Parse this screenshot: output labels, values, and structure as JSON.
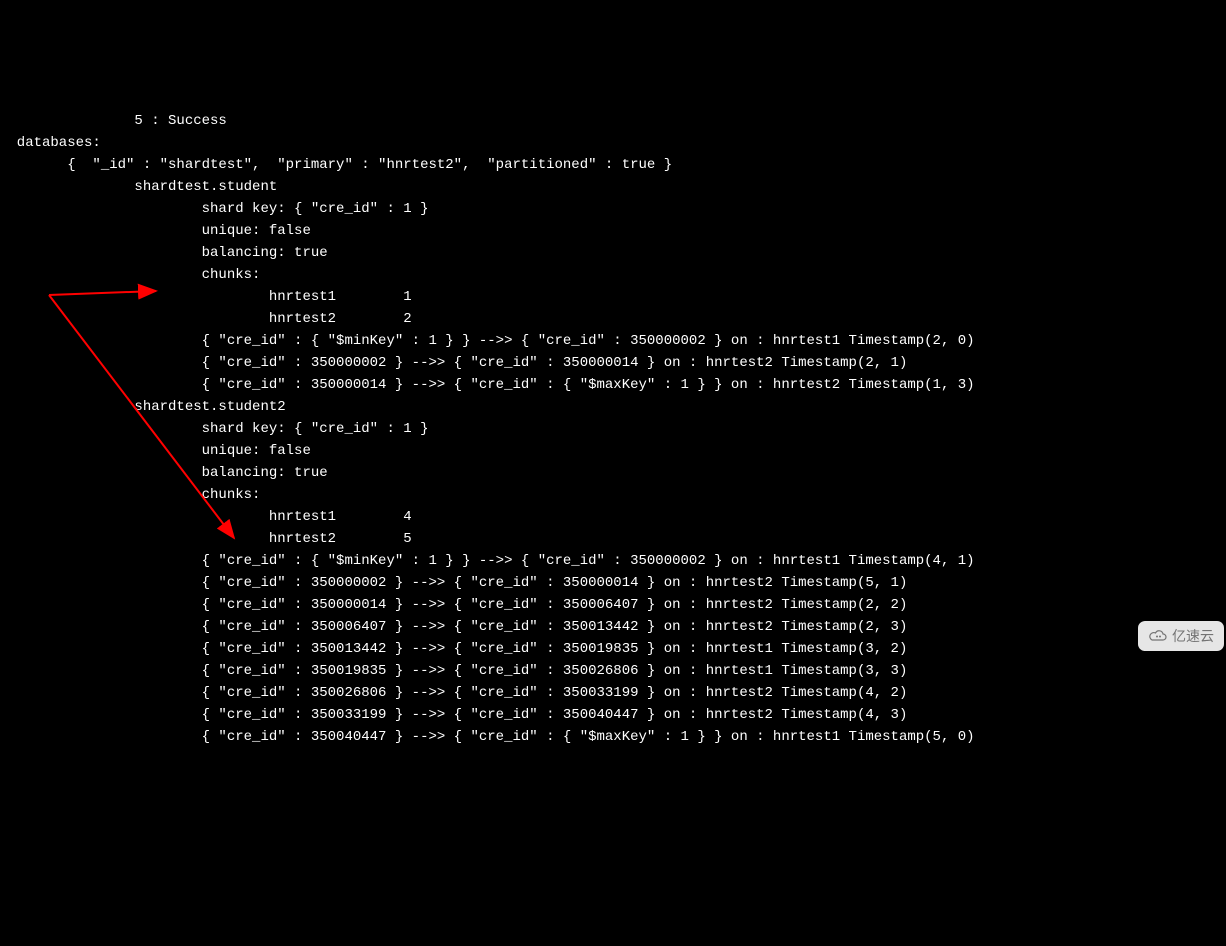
{
  "lines": {
    "l01": "                5 : Success",
    "l02": "  databases:",
    "l03": "        {  \"_id\" : \"shardtest\",  \"primary\" : \"hnrtest2\",  \"partitioned\" : true }",
    "l04": "                shardtest.student",
    "l05": "                        shard key: { \"cre_id\" : 1 }",
    "l06": "                        unique: false",
    "l07": "                        balancing: true",
    "l08": "                        chunks:",
    "l09": "                                hnrtest1        1",
    "l10": "                                hnrtest2        2",
    "l11": "                        { \"cre_id\" : { \"$minKey\" : 1 } } -->> { \"cre_id\" : 350000002 } on : hnrtest1 Timestamp(2, 0)",
    "l12": "                        { \"cre_id\" : 350000002 } -->> { \"cre_id\" : 350000014 } on : hnrtest2 Timestamp(2, 1)",
    "l13": "                        { \"cre_id\" : 350000014 } -->> { \"cre_id\" : { \"$maxKey\" : 1 } } on : hnrtest2 Timestamp(1, 3)",
    "l14": "                shardtest.student2",
    "l15": "                        shard key: { \"cre_id\" : 1 }",
    "l16": "                        unique: false",
    "l17": "                        balancing: true",
    "l18": "                        chunks:",
    "l19": "                                hnrtest1        4",
    "l20": "                                hnrtest2        5",
    "l21": "                        { \"cre_id\" : { \"$minKey\" : 1 } } -->> { \"cre_id\" : 350000002 } on : hnrtest1 Timestamp(4, 1)",
    "l22": "                        { \"cre_id\" : 350000002 } -->> { \"cre_id\" : 350000014 } on : hnrtest2 Timestamp(5, 1)",
    "l23": "                        { \"cre_id\" : 350000014 } -->> { \"cre_id\" : 350006407 } on : hnrtest2 Timestamp(2, 2)",
    "l24": "                        { \"cre_id\" : 350006407 } -->> { \"cre_id\" : 350013442 } on : hnrtest2 Timestamp(2, 3)",
    "l25": "                        { \"cre_id\" : 350013442 } -->> { \"cre_id\" : 350019835 } on : hnrtest1 Timestamp(3, 2)",
    "l26": "                        { \"cre_id\" : 350019835 } -->> { \"cre_id\" : 350026806 } on : hnrtest1 Timestamp(3, 3)",
    "l27": "                        { \"cre_id\" : 350026806 } -->> { \"cre_id\" : 350033199 } on : hnrtest2 Timestamp(4, 2)",
    "l28": "                        { \"cre_id\" : 350033199 } -->> { \"cre_id\" : 350040447 } on : hnrtest2 Timestamp(4, 3)",
    "l29": "                        { \"cre_id\" : 350040447 } -->> { \"cre_id\" : { \"$maxKey\" : 1 } } on : hnrtest1 Timestamp(5, 0)"
  },
  "watermark": "亿速云"
}
